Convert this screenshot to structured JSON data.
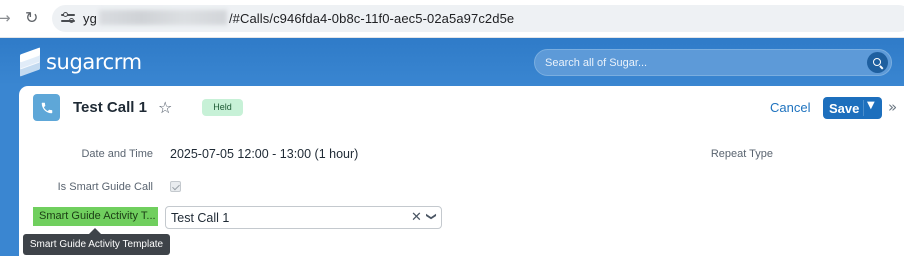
{
  "browser": {
    "nav_back": "→",
    "reload": "C",
    "url_prefix": "yg",
    "url_suffix": "/#Calls/c946fda4-0b8c-11f0-aec5-02a5a97c2d5e"
  },
  "header": {
    "logo_text": "sugarcrm",
    "search_placeholder": "Search all of Sugar..."
  },
  "record": {
    "module_icon": "phone-icon",
    "title": "Test Call 1",
    "status": "Held",
    "cancel_label": "Cancel",
    "save_label": "Save"
  },
  "fields": {
    "date_label": "Date and Time",
    "date_value": "2025-07-05 12:00 - 13:00 (1 hour)",
    "repeat_label": "Repeat Type",
    "smart_guide_label": "Is Smart Guide Call",
    "smart_guide_checked": true,
    "template_label": "Smart Guide Activity T...",
    "template_value": "Test Call 1",
    "tooltip": "Smart Guide Activity Template"
  },
  "colors": {
    "header_blue": "#3a86d1",
    "save_blue": "#1d6fbd",
    "badge_green": "#c7f1d7",
    "label_green": "#70cf5e"
  }
}
